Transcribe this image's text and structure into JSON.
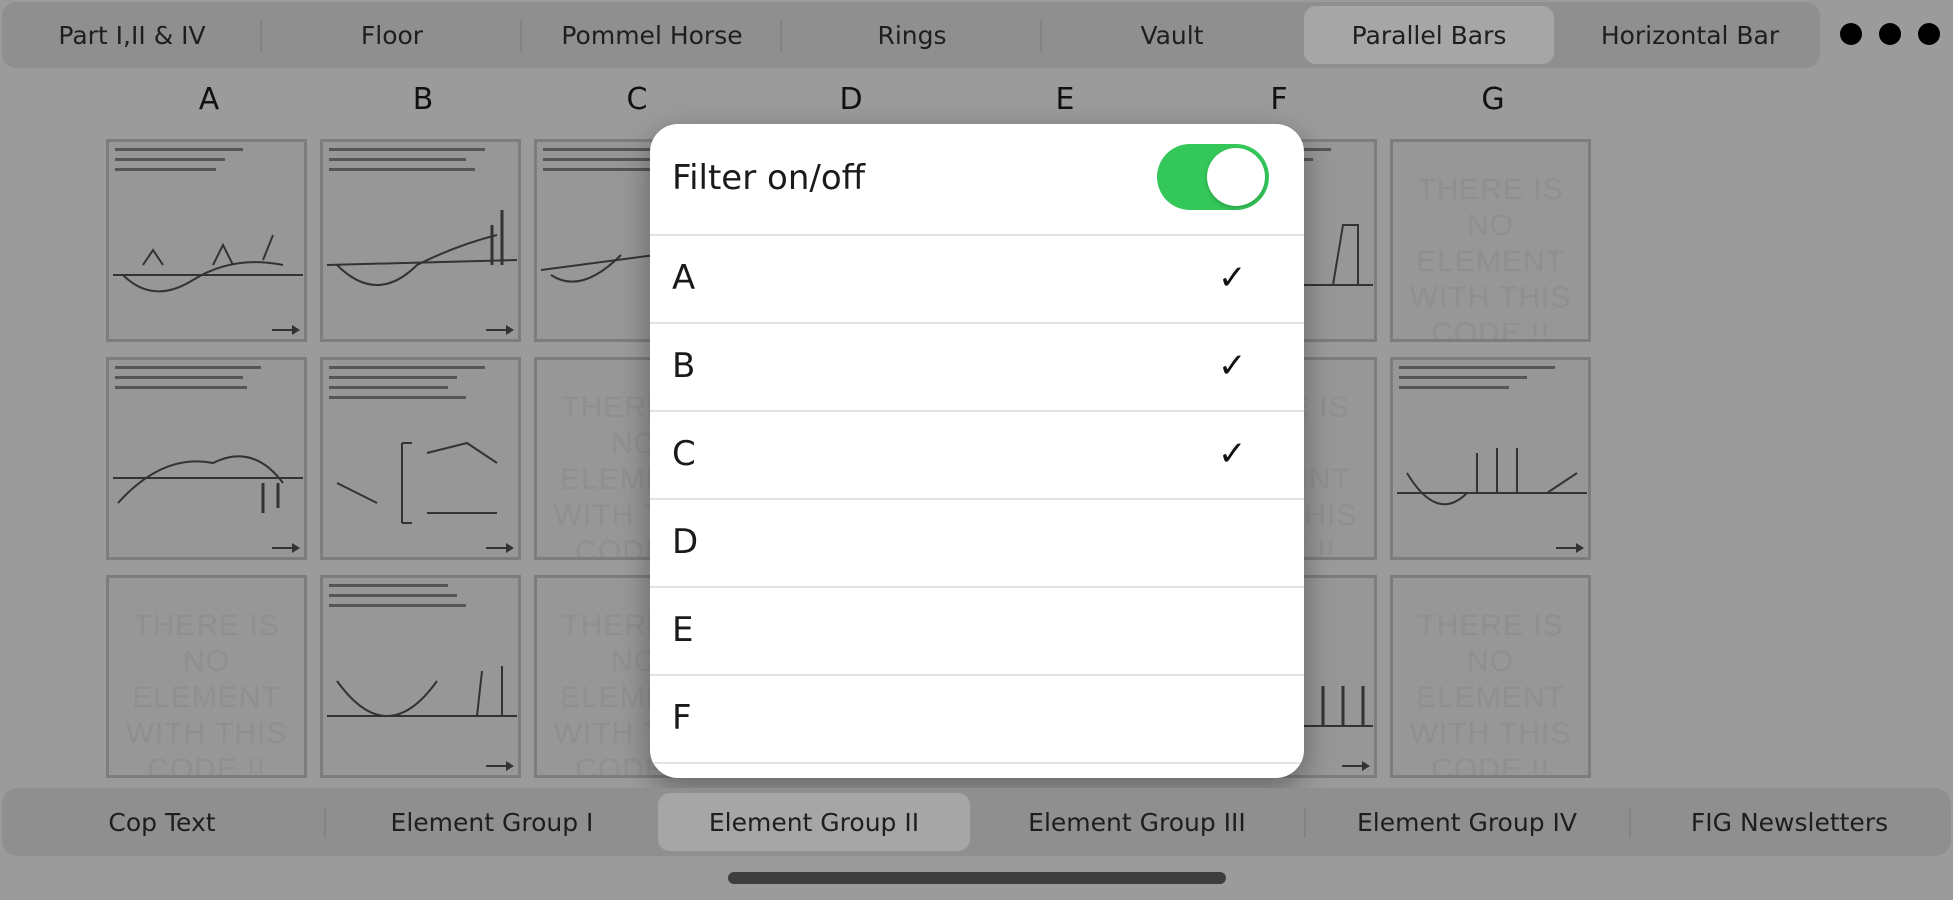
{
  "top_tabs": [
    {
      "label": "Part I,II & IV",
      "selected": false
    },
    {
      "label": "Floor",
      "selected": false
    },
    {
      "label": "Pommel Horse",
      "selected": false
    },
    {
      "label": "Rings",
      "selected": false
    },
    {
      "label": "Vault",
      "selected": false
    },
    {
      "label": "Parallel Bars",
      "selected": true
    },
    {
      "label": "Horizontal Bar",
      "selected": false
    }
  ],
  "more_icon": "ellipsis-icon",
  "columns": [
    "A",
    "B",
    "C",
    "D",
    "E",
    "F",
    "G"
  ],
  "empty_cell_text": "THERE IS NO ELEMENT WITH THIS CODE !!",
  "filter_popover": {
    "title": "Filter on/off",
    "toggle_on": true,
    "toggle_color": "#34c759",
    "items": [
      {
        "label": "A",
        "checked": true
      },
      {
        "label": "B",
        "checked": true
      },
      {
        "label": "C",
        "checked": true
      },
      {
        "label": "D",
        "checked": false
      },
      {
        "label": "E",
        "checked": false
      },
      {
        "label": "F",
        "checked": false
      }
    ]
  },
  "bottom_tabs": [
    {
      "label": "Cop Text",
      "selected": false
    },
    {
      "label": "Element Group I",
      "selected": false
    },
    {
      "label": "Element Group II",
      "selected": true
    },
    {
      "label": "Element Group III",
      "selected": false
    },
    {
      "label": "Element Group IV",
      "selected": false
    },
    {
      "label": "FIG Newsletters",
      "selected": false
    }
  ]
}
